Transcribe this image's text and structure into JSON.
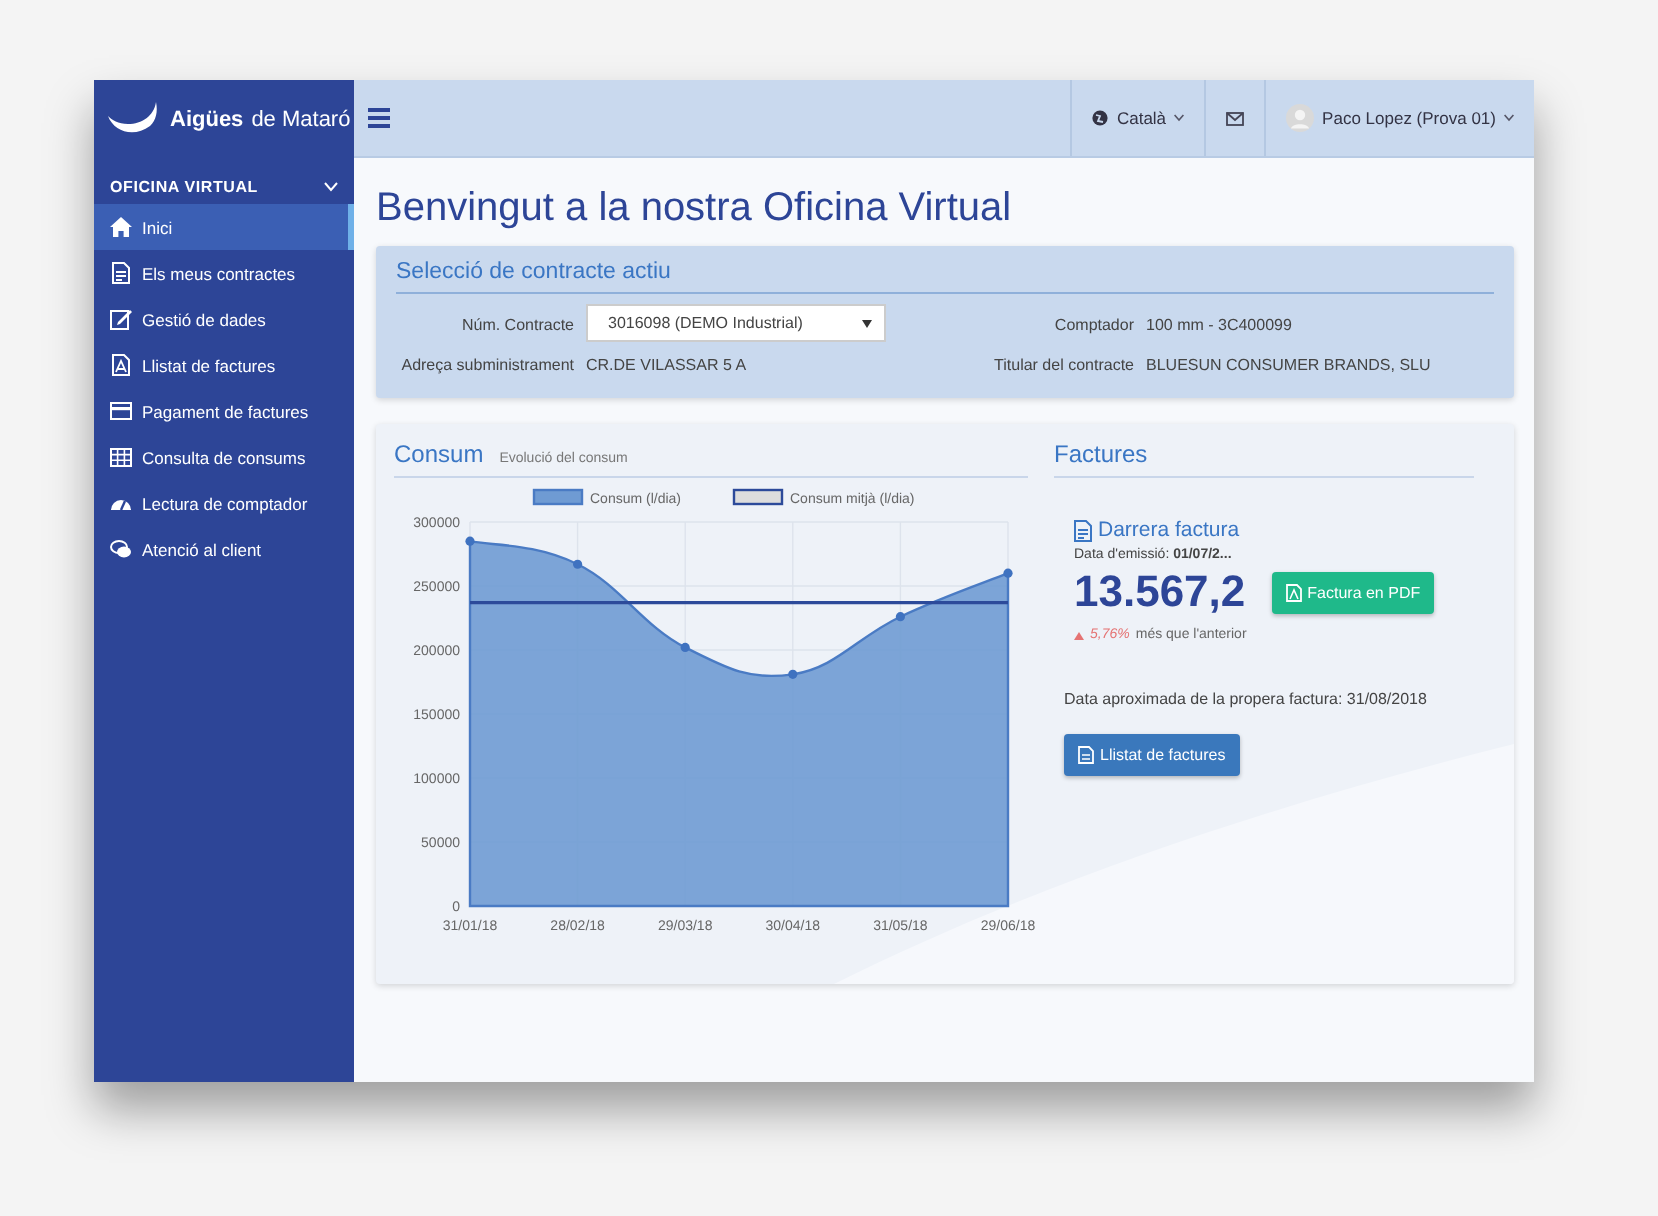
{
  "logo": {
    "brand": "Aigües",
    "place": "de Mataró"
  },
  "sidebar": {
    "section": "OFICINA VIRTUAL",
    "items": [
      {
        "label": "Inici",
        "selected": true
      },
      {
        "label": "Els meus contractes",
        "selected": false
      },
      {
        "label": "Gestió de dades",
        "selected": false
      },
      {
        "label": "Llistat de factures",
        "selected": false
      },
      {
        "label": "Pagament de factures",
        "selected": false
      },
      {
        "label": "Consulta de consums",
        "selected": false
      },
      {
        "label": "Lectura de comptador",
        "selected": false
      },
      {
        "label": "Atenció al client",
        "selected": false
      }
    ]
  },
  "topbar": {
    "language": "Català",
    "user": "Paco Lopez (Prova 01)"
  },
  "title": "Benvingut a la nostra Oficina Virtual",
  "contract_panel": {
    "title": "Selecció de contracte actiu",
    "fields": [
      {
        "label": "Núm. Contracte",
        "value": "3016098 (DEMO Industrial)",
        "kind": "select"
      },
      {
        "label": "Comptador",
        "value": "100 mm - 3C400099",
        "kind": "text"
      },
      {
        "label": "Adreça subministrament",
        "value": "CR.DE VILASSAR 5 A",
        "kind": "text"
      },
      {
        "label": "Titular del contracte",
        "value": "BLUESUN CONSUMER BRANDS, SLU",
        "kind": "text"
      }
    ]
  },
  "consum": {
    "title": "Consum",
    "subtitle": "Evolució del consum",
    "chart_data": {
      "type": "area",
      "categories": [
        "31/01/18",
        "28/02/18",
        "29/03/18",
        "30/04/18",
        "31/05/18",
        "29/06/18"
      ],
      "series": [
        {
          "name": "Consum (l/dia)",
          "type": "area",
          "color": "#6f9bd3",
          "values": [
            285000,
            267000,
            202000,
            181000,
            226000,
            260000
          ]
        },
        {
          "name": "Consum mitjà (l/dia)",
          "type": "line",
          "color": "#2c4a9a",
          "values": [
            237000,
            237000,
            237000,
            237000,
            237000,
            237000
          ]
        }
      ],
      "grid": true,
      "legend": "top",
      "ylim": [
        0,
        300000
      ],
      "yticks": [
        0,
        50000,
        100000,
        150000,
        200000,
        250000,
        300000
      ]
    }
  },
  "factures": {
    "title": "Factures",
    "last_invoice": {
      "title": "Darrera factura",
      "issue_date": "Data d'emissió: **01/07/2...**",
      "amount": "13.567,2",
      "pdf_button": "Factura en PDF",
      "change_value": "5,76%",
      "change_text": "més que l'anterior"
    },
    "next_invoice": "Data aproximada de la propera factura: 31/08/2018",
    "list_button": "Llistat de factures"
  }
}
